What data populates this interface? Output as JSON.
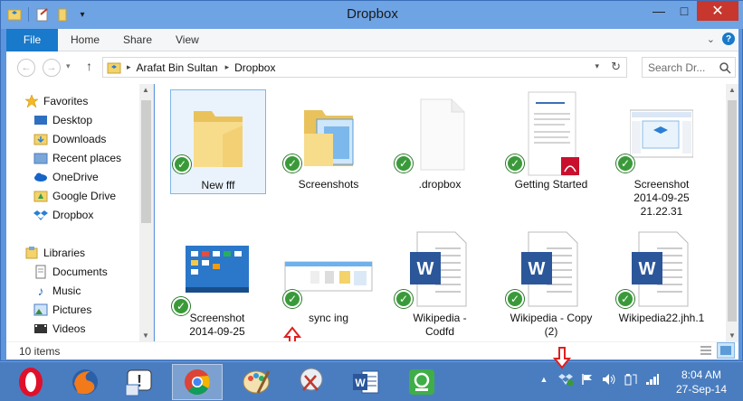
{
  "window": {
    "title": "Dropbox",
    "controls": {
      "minimize": "—",
      "maximize": "□",
      "close": "✕"
    }
  },
  "ribbon": {
    "tabs": [
      "File",
      "Home",
      "Share",
      "View"
    ]
  },
  "address": {
    "crumbs": [
      "Arafat Bin Sultan",
      "Dropbox"
    ],
    "search_placeholder": "Search Dr..."
  },
  "navpane": {
    "favorites_label": "Favorites",
    "favorites": [
      "Desktop",
      "Downloads",
      "Recent places",
      "OneDrive",
      "Google Drive",
      "Dropbox"
    ],
    "libraries_label": "Libraries",
    "libraries": [
      "Documents",
      "Music",
      "Pictures",
      "Videos"
    ]
  },
  "files": [
    {
      "label": "New fff",
      "kind": "folder",
      "synced": true,
      "selected": true
    },
    {
      "label": "Screenshots",
      "kind": "folder-screens",
      "synced": true
    },
    {
      "label": ".dropbox",
      "kind": "blank",
      "synced": true
    },
    {
      "label": "Getting Started",
      "kind": "pdf",
      "synced": true
    },
    {
      "label": "Screenshot\n2014-09-25\n21.22.31",
      "kind": "screenshot",
      "synced": true
    },
    {
      "label": "Screenshot\n2014-09-25",
      "kind": "screenshot-desktop",
      "synced": true
    },
    {
      "label": "sync ing",
      "kind": "screenshot-strip",
      "synced": true
    },
    {
      "label": "Wikipedia -\nCodfd",
      "kind": "word",
      "synced": true
    },
    {
      "label": "Wikipedia - Copy\n(2)",
      "kind": "word",
      "synced": true
    },
    {
      "label": "Wikipedia22.jhh.1",
      "kind": "word",
      "synced": true
    }
  ],
  "status": {
    "item_count": "10 items"
  },
  "taskbar": {
    "apps": [
      "opera",
      "firefox",
      "help-tool",
      "chrome",
      "paint",
      "snipping-tool",
      "word",
      "app-green"
    ],
    "clock_time": "8:04 AM",
    "clock_date": "27-Sep-14"
  },
  "colors": {
    "accent": "#1979ca",
    "sync_check": "#3a9a3a",
    "annotation": "#e02020"
  }
}
